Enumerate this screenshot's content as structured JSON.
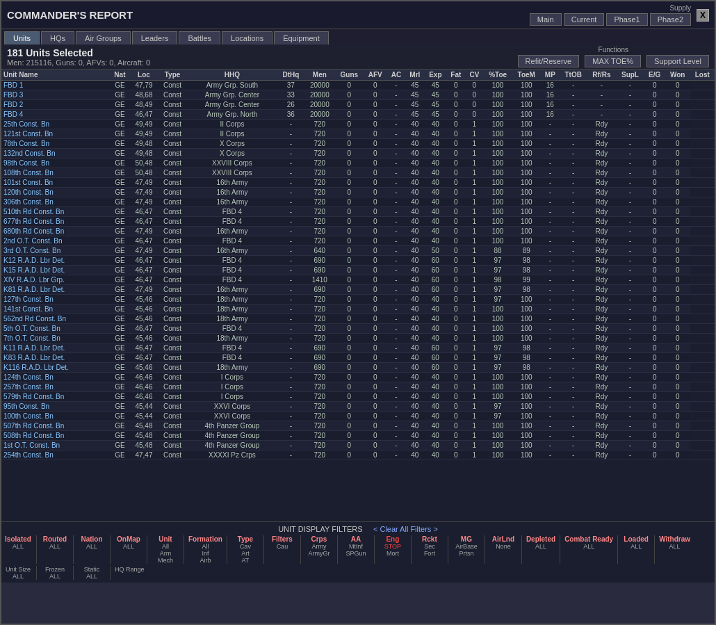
{
  "window": {
    "title": "COMMANDER'S REPORT",
    "close_label": "X"
  },
  "supply": {
    "label": "Supply",
    "tabs": [
      {
        "label": "Main",
        "active": true
      },
      {
        "label": "Current",
        "active": false
      },
      {
        "label": "Phase1",
        "active": false
      },
      {
        "label": "Phase2",
        "active": false
      }
    ]
  },
  "nav_tabs": [
    {
      "label": "Units",
      "active": true
    },
    {
      "label": "HQs",
      "active": false
    },
    {
      "label": "Air Groups",
      "active": false
    },
    {
      "label": "Leaders",
      "active": false
    },
    {
      "label": "Battles",
      "active": false
    },
    {
      "label": "Locations",
      "active": false
    },
    {
      "label": "Equipment",
      "active": false
    }
  ],
  "selected": {
    "title": "181 Units Selected",
    "sub": "Men: 215116, Guns: 0, AFVs: 0, Aircraft: 0"
  },
  "functions": {
    "label": "Functions",
    "buttons": [
      {
        "label": "Refit/Reserve"
      },
      {
        "label": "MAX TOE%"
      },
      {
        "label": "Support Level"
      }
    ]
  },
  "table": {
    "headers": [
      "Unit Name",
      "Nat",
      "Loc",
      "Type",
      "HHQ",
      "DtHq",
      "Men",
      "Guns",
      "AFV",
      "AC",
      "Mrl",
      "Exp",
      "Fat",
      "CV",
      "%Toe",
      "ToeM",
      "MP",
      "TtOB",
      "Rf/Rs",
      "SupL",
      "E/G",
      "Won",
      "Lost"
    ],
    "rows": [
      [
        "FBD 1",
        "GE",
        "47,79",
        "Const",
        "Army Grp. South",
        "37",
        "20000",
        "0",
        "0",
        "-",
        "45",
        "45",
        "0",
        "0",
        "100",
        "100",
        "16",
        "-",
        "-",
        "-",
        "0",
        "0"
      ],
      [
        "FBD 3",
        "GE",
        "48,68",
        "Const",
        "Army Grp. Center",
        "33",
        "20000",
        "0",
        "0",
        "-",
        "45",
        "45",
        "0",
        "0",
        "100",
        "100",
        "16",
        "-",
        "-",
        "-",
        "0",
        "0"
      ],
      [
        "FBD 2",
        "GE",
        "48,49",
        "Const",
        "Army Grp. Center",
        "26",
        "20000",
        "0",
        "0",
        "-",
        "45",
        "45",
        "0",
        "0",
        "100",
        "100",
        "16",
        "-",
        "-",
        "-",
        "0",
        "0"
      ],
      [
        "FBD 4",
        "GE",
        "46,47",
        "Const",
        "Army Grp. North",
        "36",
        "20000",
        "0",
        "0",
        "-",
        "45",
        "45",
        "0",
        "0",
        "100",
        "100",
        "16",
        "-",
        "-",
        "-",
        "0",
        "0"
      ],
      [
        "25th Const. Bn",
        "GE",
        "49,49",
        "Const",
        "II Corps",
        "-",
        "720",
        "0",
        "0",
        "-",
        "40",
        "40",
        "0",
        "1",
        "100",
        "100",
        "-",
        "-",
        "Rdy",
        "-",
        "0",
        "0"
      ],
      [
        "121st Const. Bn",
        "GE",
        "49,49",
        "Const",
        "II Corps",
        "-",
        "720",
        "0",
        "0",
        "-",
        "40",
        "40",
        "0",
        "1",
        "100",
        "100",
        "-",
        "-",
        "Rdy",
        "-",
        "0",
        "0"
      ],
      [
        "78th Const. Bn",
        "GE",
        "49,48",
        "Const",
        "X Corps",
        "-",
        "720",
        "0",
        "0",
        "-",
        "40",
        "40",
        "0",
        "1",
        "100",
        "100",
        "-",
        "-",
        "Rdy",
        "-",
        "0",
        "0"
      ],
      [
        "132nd Const. Bn",
        "GE",
        "49,48",
        "Const",
        "X Corps",
        "-",
        "720",
        "0",
        "0",
        "-",
        "40",
        "40",
        "0",
        "1",
        "100",
        "100",
        "-",
        "-",
        "Rdy",
        "-",
        "0",
        "0"
      ],
      [
        "98th Const. Bn",
        "GE",
        "50,48",
        "Const",
        "XXVIII Corps",
        "-",
        "720",
        "0",
        "0",
        "-",
        "40",
        "40",
        "0",
        "1",
        "100",
        "100",
        "-",
        "-",
        "Rdy",
        "-",
        "0",
        "0"
      ],
      [
        "108th Const. Bn",
        "GE",
        "50,48",
        "Const",
        "XXVIII Corps",
        "-",
        "720",
        "0",
        "0",
        "-",
        "40",
        "40",
        "0",
        "1",
        "100",
        "100",
        "-",
        "-",
        "Rdy",
        "-",
        "0",
        "0"
      ],
      [
        "101st Const. Bn",
        "GE",
        "47,49",
        "Const",
        "16th Army",
        "-",
        "720",
        "0",
        "0",
        "-",
        "40",
        "40",
        "0",
        "1",
        "100",
        "100",
        "-",
        "-",
        "Rdy",
        "-",
        "0",
        "0"
      ],
      [
        "120th Const. Bn",
        "GE",
        "47,49",
        "Const",
        "16th Army",
        "-",
        "720",
        "0",
        "0",
        "-",
        "40",
        "40",
        "0",
        "1",
        "100",
        "100",
        "-",
        "-",
        "Rdy",
        "-",
        "0",
        "0"
      ],
      [
        "306th Const. Bn",
        "GE",
        "47,49",
        "Const",
        "16th Army",
        "-",
        "720",
        "0",
        "0",
        "-",
        "40",
        "40",
        "0",
        "1",
        "100",
        "100",
        "-",
        "-",
        "Rdy",
        "-",
        "0",
        "0"
      ],
      [
        "510th Rd Const. Bn",
        "GE",
        "46,47",
        "Const",
        "FBD 4",
        "-",
        "720",
        "0",
        "0",
        "-",
        "40",
        "40",
        "0",
        "1",
        "100",
        "100",
        "-",
        "-",
        "Rdy",
        "-",
        "0",
        "0"
      ],
      [
        "677th Rd Const. Bn",
        "GE",
        "46,47",
        "Const",
        "FBD 4",
        "-",
        "720",
        "0",
        "0",
        "-",
        "40",
        "40",
        "0",
        "1",
        "100",
        "100",
        "-",
        "-",
        "Rdy",
        "-",
        "0",
        "0"
      ],
      [
        "680th Rd Const. Bn",
        "GE",
        "47,49",
        "Const",
        "16th Army",
        "-",
        "720",
        "0",
        "0",
        "-",
        "40",
        "40",
        "0",
        "1",
        "100",
        "100",
        "-",
        "-",
        "Rdy",
        "-",
        "0",
        "0"
      ],
      [
        "2nd O.T. Const. Bn",
        "GE",
        "46,47",
        "Const",
        "FBD 4",
        "-",
        "720",
        "0",
        "0",
        "-",
        "40",
        "40",
        "0",
        "1",
        "100",
        "100",
        "-",
        "-",
        "Rdy",
        "-",
        "0",
        "0"
      ],
      [
        "3rd O.T. Const. Bn",
        "GE",
        "47,49",
        "Const",
        "16th Army",
        "-",
        "640",
        "0",
        "0",
        "-",
        "40",
        "50",
        "0",
        "1",
        "88",
        "89",
        "-",
        "-",
        "Rdy",
        "-",
        "0",
        "0"
      ],
      [
        "K12 R.A.D. Lbr Det.",
        "GE",
        "46,47",
        "Const",
        "FBD 4",
        "-",
        "690",
        "0",
        "0",
        "-",
        "40",
        "60",
        "0",
        "1",
        "97",
        "98",
        "-",
        "-",
        "Rdy",
        "-",
        "0",
        "0"
      ],
      [
        "K15 R.A.D. Lbr Det.",
        "GE",
        "46,47",
        "Const",
        "FBD 4",
        "-",
        "690",
        "0",
        "0",
        "-",
        "40",
        "60",
        "0",
        "1",
        "97",
        "98",
        "-",
        "-",
        "Rdy",
        "-",
        "0",
        "0"
      ],
      [
        "XIV R.A.D. Lbr Grp.",
        "GE",
        "46,47",
        "Const",
        "FBD 4",
        "-",
        "1410",
        "0",
        "0",
        "-",
        "40",
        "60",
        "0",
        "1",
        "98",
        "99",
        "-",
        "-",
        "Rdy",
        "-",
        "0",
        "0"
      ],
      [
        "K81 R.A.D. Lbr Det.",
        "GE",
        "47,49",
        "Const",
        "16th Army",
        "-",
        "690",
        "0",
        "0",
        "-",
        "40",
        "60",
        "0",
        "1",
        "97",
        "98",
        "-",
        "-",
        "Rdy",
        "-",
        "0",
        "0"
      ],
      [
        "127th Const. Bn",
        "GE",
        "45,46",
        "Const",
        "18th Army",
        "-",
        "720",
        "0",
        "0",
        "-",
        "40",
        "40",
        "0",
        "1",
        "97",
        "100",
        "-",
        "-",
        "Rdy",
        "-",
        "0",
        "0"
      ],
      [
        "141st Const. Bn",
        "GE",
        "45,46",
        "Const",
        "18th Army",
        "-",
        "720",
        "0",
        "0",
        "-",
        "40",
        "40",
        "0",
        "1",
        "100",
        "100",
        "-",
        "-",
        "Rdy",
        "-",
        "0",
        "0"
      ],
      [
        "562nd Rd Const. Bn",
        "GE",
        "45,46",
        "Const",
        "18th Army",
        "-",
        "720",
        "0",
        "0",
        "-",
        "40",
        "40",
        "0",
        "1",
        "100",
        "100",
        "-",
        "-",
        "Rdy",
        "-",
        "0",
        "0"
      ],
      [
        "5th O.T. Const. Bn",
        "GE",
        "46,47",
        "Const",
        "FBD 4",
        "-",
        "720",
        "0",
        "0",
        "-",
        "40",
        "40",
        "0",
        "1",
        "100",
        "100",
        "-",
        "-",
        "Rdy",
        "-",
        "0",
        "0"
      ],
      [
        "7th O.T. Const. Bn",
        "GE",
        "45,46",
        "Const",
        "18th Army",
        "-",
        "720",
        "0",
        "0",
        "-",
        "40",
        "40",
        "0",
        "1",
        "100",
        "100",
        "-",
        "-",
        "Rdy",
        "-",
        "0",
        "0"
      ],
      [
        "K11 R.A.D. Lbr Det.",
        "GE",
        "46,47",
        "Const",
        "FBD 4",
        "-",
        "690",
        "0",
        "0",
        "-",
        "40",
        "60",
        "0",
        "1",
        "97",
        "98",
        "-",
        "-",
        "Rdy",
        "-",
        "0",
        "0"
      ],
      [
        "K83 R.A.D. Lbr Det.",
        "GE",
        "46,47",
        "Const",
        "FBD 4",
        "-",
        "690",
        "0",
        "0",
        "-",
        "40",
        "60",
        "0",
        "1",
        "97",
        "98",
        "-",
        "-",
        "Rdy",
        "-",
        "0",
        "0"
      ],
      [
        "K116 R.A.D. Lbr Det.",
        "GE",
        "45,46",
        "Const",
        "18th Army",
        "-",
        "690",
        "0",
        "0",
        "-",
        "40",
        "60",
        "0",
        "1",
        "97",
        "98",
        "-",
        "-",
        "Rdy",
        "-",
        "0",
        "0"
      ],
      [
        "124th Const. Bn",
        "GE",
        "46,46",
        "Const",
        "I Corps",
        "-",
        "720",
        "0",
        "0",
        "-",
        "40",
        "40",
        "0",
        "1",
        "100",
        "100",
        "-",
        "-",
        "Rdy",
        "-",
        "0",
        "0"
      ],
      [
        "257th Const. Bn",
        "GE",
        "46,46",
        "Const",
        "I Corps",
        "-",
        "720",
        "0",
        "0",
        "-",
        "40",
        "40",
        "0",
        "1",
        "100",
        "100",
        "-",
        "-",
        "Rdy",
        "-",
        "0",
        "0"
      ],
      [
        "579th Rd Const. Bn",
        "GE",
        "46,46",
        "Const",
        "I Corps",
        "-",
        "720",
        "0",
        "0",
        "-",
        "40",
        "40",
        "0",
        "1",
        "100",
        "100",
        "-",
        "-",
        "Rdy",
        "-",
        "0",
        "0"
      ],
      [
        "95th Const. Bn",
        "GE",
        "45,44",
        "Const",
        "XXVI Corps",
        "-",
        "720",
        "0",
        "0",
        "-",
        "40",
        "40",
        "0",
        "1",
        "97",
        "100",
        "-",
        "-",
        "Rdy",
        "-",
        "0",
        "0"
      ],
      [
        "100th Const. Bn",
        "GE",
        "45,44",
        "Const",
        "XXVI Corps",
        "-",
        "720",
        "0",
        "0",
        "-",
        "40",
        "40",
        "0",
        "1",
        "97",
        "100",
        "-",
        "-",
        "Rdy",
        "-",
        "0",
        "0"
      ],
      [
        "507th Rd Const. Bn",
        "GE",
        "45,48",
        "Const",
        "4th Panzer Group",
        "-",
        "720",
        "0",
        "0",
        "-",
        "40",
        "40",
        "0",
        "1",
        "100",
        "100",
        "-",
        "-",
        "Rdy",
        "-",
        "0",
        "0"
      ],
      [
        "508th Rd Const. Bn",
        "GE",
        "45,48",
        "Const",
        "4th Panzer Group",
        "-",
        "720",
        "0",
        "0",
        "-",
        "40",
        "40",
        "0",
        "1",
        "100",
        "100",
        "-",
        "-",
        "Rdy",
        "-",
        "0",
        "0"
      ],
      [
        "1st O.T. Const. Bn",
        "GE",
        "45,48",
        "Const",
        "4th Panzer Group",
        "-",
        "720",
        "0",
        "0",
        "-",
        "40",
        "40",
        "0",
        "1",
        "100",
        "100",
        "-",
        "-",
        "Rdy",
        "-",
        "0",
        "0"
      ],
      [
        "254th Const. Bn",
        "GE",
        "47,47",
        "Const",
        "XXXXI Pz Crps",
        "-",
        "720",
        "0",
        "0",
        "-",
        "40",
        "40",
        "0",
        "1",
        "100",
        "100",
        "-",
        "-",
        "Rdy",
        "-",
        "0",
        "0"
      ]
    ]
  },
  "filters": {
    "title": "UNIT DISPLAY FILTERS",
    "clear_label": "< Clear All Filters >",
    "groups": [
      {
        "label": "Isolated",
        "sub": "ALL"
      },
      {
        "label": "Routed",
        "sub": "ALL"
      },
      {
        "label": "Nation",
        "sub": "ALL"
      },
      {
        "label": "OnMap",
        "sub": "ALL"
      },
      {
        "label": "Unit",
        "sub": "All",
        "sub2": "Arm",
        "sub3": "Mech"
      },
      {
        "label": "Formation",
        "sub": "All",
        "sub2": "Inf",
        "sub3": "Airb"
      },
      {
        "label": "Type",
        "sub": "Cav",
        "sub2": "Art",
        "sub3": "AT"
      },
      {
        "label": "Filters",
        "sub": "Cau"
      },
      {
        "label": "Crps",
        "sub": "Army",
        "sub2": "ArmyGr"
      },
      {
        "label": "AA",
        "sub": "MtInf",
        "sub2": "SPGun"
      },
      {
        "label": "Eng",
        "sub": "STOP",
        "sub2": "Mort"
      },
      {
        "label": "Rckt",
        "sub": "Sec",
        "sub2": "Fort"
      },
      {
        "label": "MG",
        "sub": "AirBase",
        "sub2": "Prtsn"
      },
      {
        "label": "AirLnd",
        "sub": "None"
      },
      {
        "label": "Depleted",
        "sub": "ALL"
      },
      {
        "label": "Combat Ready",
        "sub": "ALL"
      },
      {
        "label": "Loaded",
        "sub": "ALL"
      },
      {
        "label": "Withdraw",
        "sub": "ALL"
      }
    ],
    "bottom_groups": [
      {
        "label": "Unit Size",
        "sub": "ALL"
      },
      {
        "label": "Frozen",
        "sub": "ALL"
      },
      {
        "label": "Static",
        "sub": "ALL"
      },
      {
        "label": "HQ Range"
      },
      {
        "label": "HQ Range"
      }
    ]
  }
}
